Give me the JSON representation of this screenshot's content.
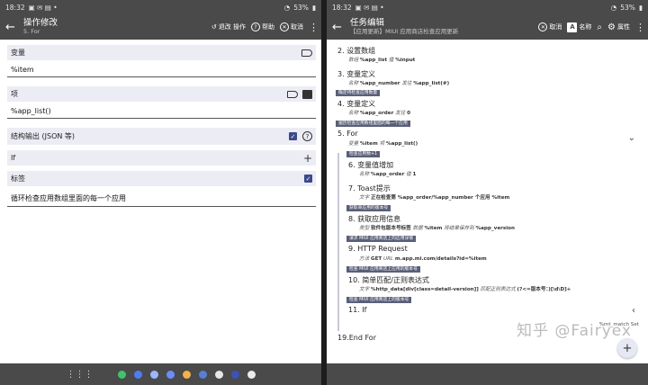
{
  "left": {
    "status": {
      "time": "18:32",
      "battery": "53%"
    },
    "appbar": {
      "title": "操作修改",
      "subtitle": "5. For",
      "revert": "退改 操作",
      "help": "帮助",
      "cancel": "取消"
    },
    "fields": [
      {
        "label": "变量",
        "value": "%item"
      },
      {
        "label": "项",
        "value": "%app_list()"
      },
      {
        "label": "结构输出 (JSON 等)"
      },
      {
        "label": "If"
      },
      {
        "label": "标签",
        "value": "循环检查应用数组里面的每一个应用"
      }
    ]
  },
  "right": {
    "status": {
      "time": "18:32",
      "battery": "53%"
    },
    "appbar": {
      "title": "任务编辑",
      "subtitle": "【应用更新】MIUI 应用商店检查应用更新",
      "cancel": "取消",
      "name": "名称",
      "props": "属性"
    },
    "tasks": [
      {
        "n": "2.",
        "name": "设置数组",
        "sub_k": "数组",
        "sub_v": "%app_list",
        "sub_k2": "值",
        "sub_v2": "%input"
      },
      {
        "n": "3.",
        "name": "变量定义",
        "sub_k": "名称",
        "sub_v": "%app_number",
        "sub_k2": "发往",
        "sub_v2": "%app_list(#)"
      },
      {
        "label": "确定待检查应用数量"
      },
      {
        "n": "4.",
        "name": "变量定义",
        "sub_k": "名称",
        "sub_v": "%app_order",
        "sub_k2": "发往",
        "sub_v2": "0"
      },
      {
        "label": "遍历检查应用数组里面的每一个应用"
      },
      {
        "n": "5.",
        "name": "For",
        "sub_k": "变量",
        "sub_v": "%item",
        "sub_k2": "项",
        "sub_v2": "%app_list()"
      },
      {
        "label": "检查应用数+1"
      },
      {
        "n": "6.",
        "name": "变量值增加",
        "sub_k": "名称",
        "sub_v": "%app_order",
        "sub_k2": "值",
        "sub_v2": "1"
      },
      {
        "n": "7.",
        "name": "Toast提示",
        "sub_k": "文字",
        "sub_v": "正在检查第 %app_order/%app_number 个应用 %item"
      },
      {
        "label": "获取单应用的版本号"
      },
      {
        "n": "8.",
        "name": "获取应用信息",
        "sub_k": "类型",
        "sub_v": "软件包版本号标签",
        "sub_k2": "数据",
        "sub_v2": "%item",
        "sub_k3": "将结果保存到",
        "sub_v3": "%app_version"
      },
      {
        "label": "请求 MIUI 应用商店上的应用详情"
      },
      {
        "n": "9.",
        "name": "HTTP Request",
        "sub_k": "方法",
        "sub_v": "GET",
        "sub_k2": "URL",
        "sub_v2": "m.app.mi.com/details?id=%item"
      },
      {
        "label": "检查 MIUI 应用商店上应用的版本号"
      },
      {
        "n": "10.",
        "name": "简单匹配/正则表达式",
        "sub_k": "文字",
        "sub_v": "%http_data[div[class=detail-version]]",
        "sub_k2": "匹配正则表达式",
        "sub_v2": "(?<=版本号：)[\\d\\D]+"
      },
      {
        "label": "检查 MIUI 应用商店上的版本号"
      },
      {
        "n": "11.",
        "name": "If",
        "sub_v": "%mt_match Set"
      },
      {
        "n": "19.",
        "name": "End For"
      }
    ],
    "watermark": "知乎 @Fairyex"
  }
}
